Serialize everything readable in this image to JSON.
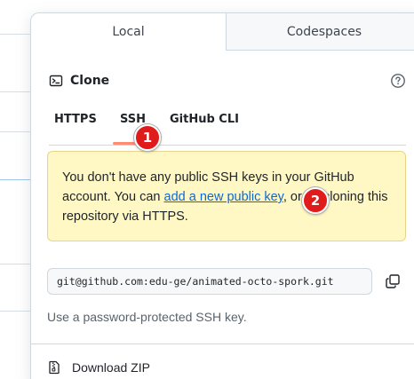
{
  "tabs": [
    {
      "label": "Local",
      "active": true
    },
    {
      "label": "Codespaces",
      "active": false
    }
  ],
  "clone": {
    "title": "Clone",
    "icon": "terminal-icon",
    "help_icon": "question-circle-icon"
  },
  "protocols": [
    {
      "label": "HTTPS",
      "selected": false
    },
    {
      "label": "SSH",
      "selected": true
    },
    {
      "label": "GitHub CLI",
      "selected": false
    }
  ],
  "warning": {
    "text_before": "You don't have any public SSH keys in your GitHub account. You can ",
    "link": "add a new public key",
    "text_after": ", or try cloning this repository via HTTPS."
  },
  "ssh_url": {
    "value": "git@github.com:edu-ge/animated-octo-spork.git",
    "copy_icon": "copy-icon"
  },
  "ssh_note": "Use a password-protected SSH key.",
  "download": {
    "label": "Download ZIP",
    "icon": "file-zip-icon"
  },
  "markers": [
    {
      "label": "1"
    },
    {
      "label": "2"
    }
  ],
  "colors": {
    "warning_bg": "#fff8c5",
    "link": "#0969da",
    "tab_underline": "#fd8c73",
    "marker": "#e01b1b"
  }
}
